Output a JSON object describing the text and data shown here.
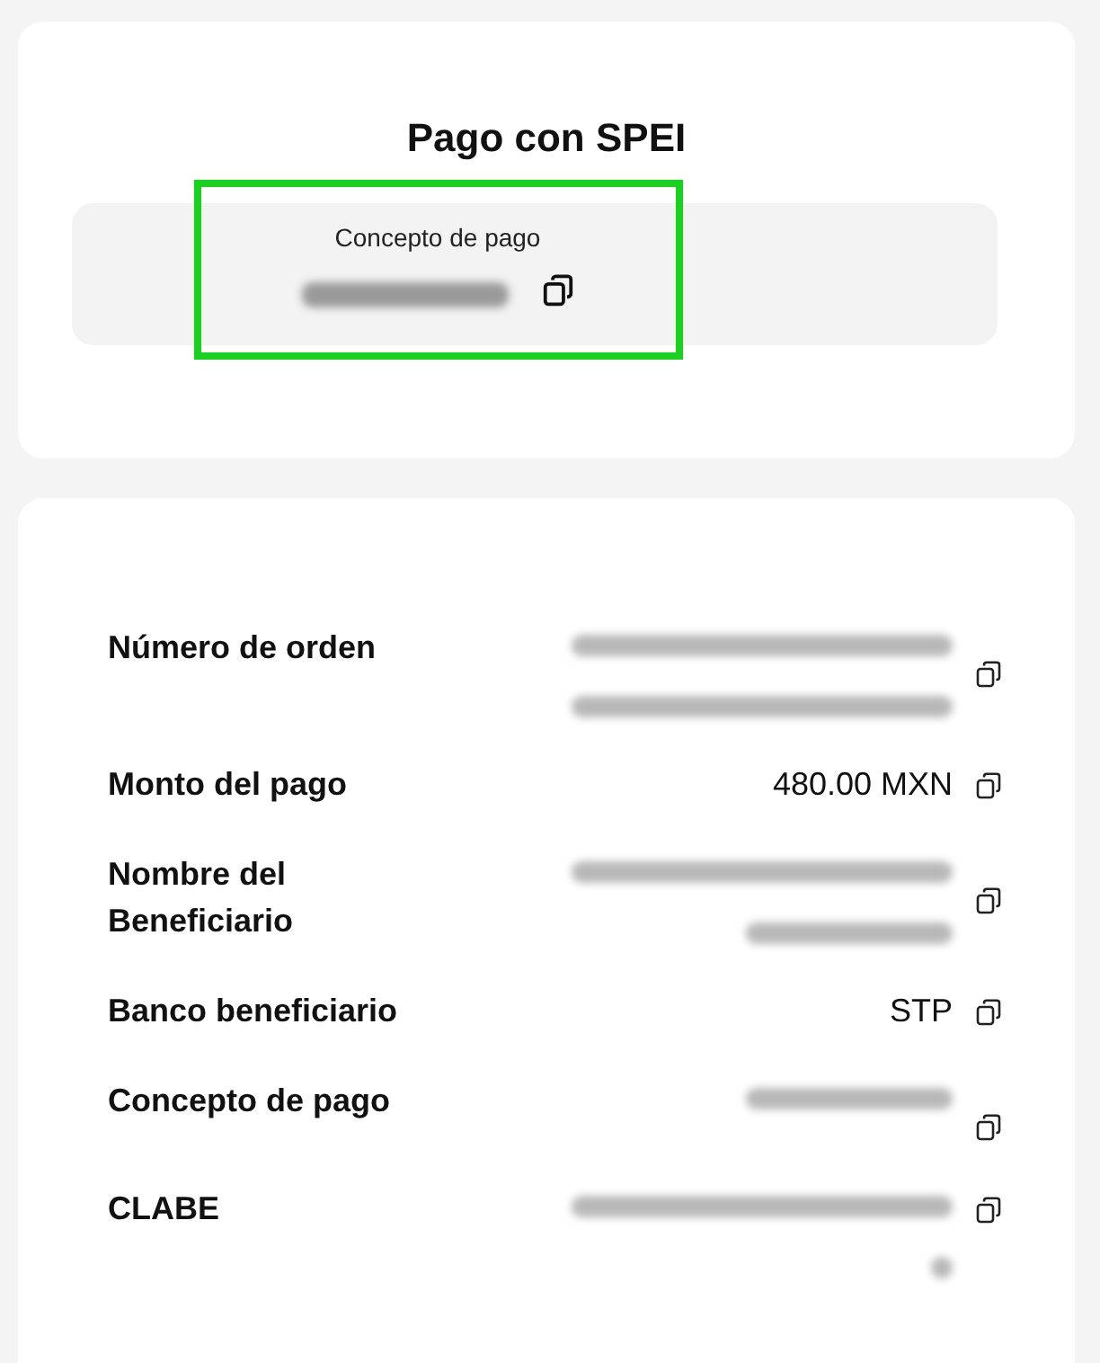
{
  "header": {
    "title": "Pago con SPEI",
    "concept": {
      "label": "Concepto de pago",
      "highlighted": true,
      "value": {
        "kind": "redacted",
        "lines": [
          {
            "wide": false,
            "tiny": false
          }
        ]
      }
    }
  },
  "details": [
    {
      "label": "Número de orden",
      "value": {
        "kind": "redacted",
        "lines": [
          {
            "wide": true,
            "tiny": false
          },
          {
            "wide": true,
            "tiny": false
          }
        ]
      }
    },
    {
      "label": "Monto del pago",
      "value": {
        "kind": "text",
        "text": "480.00 MXN"
      }
    },
    {
      "label": "Nombre del Beneficiario",
      "value": {
        "kind": "redacted",
        "lines": [
          {
            "wide": true,
            "tiny": false
          },
          {
            "wide": false,
            "tiny": false
          }
        ]
      }
    },
    {
      "label": "Banco beneficiario",
      "value": {
        "kind": "text",
        "text": "STP"
      }
    },
    {
      "label": "Concepto de pago",
      "value": {
        "kind": "redacted",
        "lines": [
          {
            "wide": false,
            "tiny": false
          }
        ]
      }
    },
    {
      "label": "CLABE",
      "value": {
        "kind": "redacted",
        "lines": [
          {
            "wide": true,
            "tiny": false
          },
          {
            "wide": false,
            "tiny": true
          }
        ]
      }
    }
  ]
}
